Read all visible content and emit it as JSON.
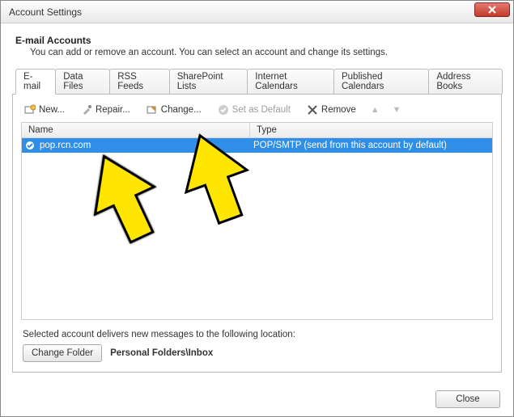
{
  "window": {
    "title": "Account Settings"
  },
  "header": {
    "title": "E-mail Accounts",
    "desc": "You can add or remove an account. You can select an account and change its settings."
  },
  "tabs": [
    {
      "label": "E-mail",
      "active": true
    },
    {
      "label": "Data Files"
    },
    {
      "label": "RSS Feeds"
    },
    {
      "label": "SharePoint Lists"
    },
    {
      "label": "Internet Calendars"
    },
    {
      "label": "Published Calendars"
    },
    {
      "label": "Address Books"
    }
  ],
  "toolbar": {
    "new_label": "New...",
    "repair_label": "Repair...",
    "change_label": "Change...",
    "setdefault_label": "Set as Default",
    "remove_label": "Remove"
  },
  "grid": {
    "columns": {
      "name": "Name",
      "type": "Type"
    },
    "rows": [
      {
        "name": "pop.rcn.com",
        "type": "POP/SMTP (send from this account by default)"
      }
    ]
  },
  "footer": {
    "caption": "Selected account delivers new messages to the following location:",
    "change_folder": "Change Folder",
    "folder_path": "Personal Folders\\Inbox"
  },
  "dialog": {
    "close": "Close"
  }
}
